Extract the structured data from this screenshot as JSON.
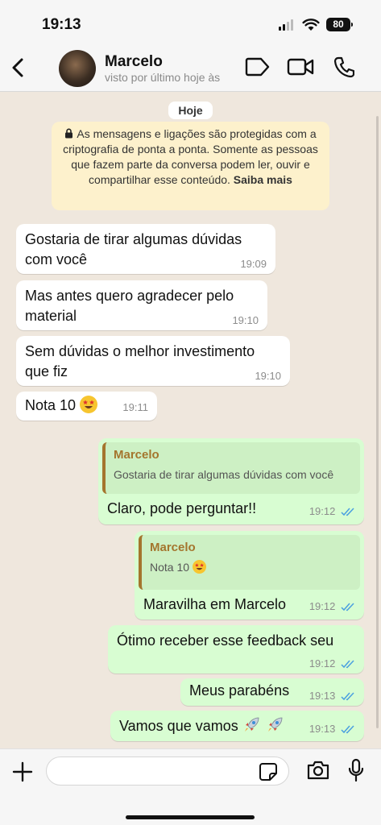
{
  "status_bar": {
    "time": "19:13",
    "battery": "80"
  },
  "header": {
    "contact_name": "Marcelo",
    "contact_status": "visto por último hoje às"
  },
  "chat": {
    "date_chip": "Hoje",
    "encryption_notice": {
      "text": "As mensagens e ligações são protegidas com a criptografia de ponta a ponta. Somente as pessoas que fazem parte da conversa podem ler, ouvir e compartilhar esse conteúdo.",
      "link": "Saiba mais"
    },
    "incoming": [
      {
        "text": "Gostaria de tirar algumas dúvidas com você",
        "time": "19:09"
      },
      {
        "text": "Mas antes quero agradecer pelo material",
        "time": "19:10"
      },
      {
        "text": "Sem dúvidas o melhor investimento que fiz",
        "time": "19:10"
      },
      {
        "text": "Nota 10",
        "time": "19:11"
      }
    ],
    "outgoing": [
      {
        "quote_name": "Marcelo",
        "quote_text": "Gostaria de tirar algumas dúvidas com você",
        "text": "Claro, pode perguntar!!",
        "time": "19:12"
      },
      {
        "quote_name": "Marcelo",
        "quote_text": "Nota 10",
        "text": "Maravilha em Marcelo",
        "time": "19:12"
      },
      {
        "text": "Ótimo receber esse feedback seu",
        "time": "19:12"
      },
      {
        "text": "Meus parabéns",
        "time": "19:13"
      },
      {
        "text": "Vamos que vamos",
        "time": "19:13"
      }
    ]
  },
  "composer": {
    "placeholder": ""
  },
  "colors": {
    "outgoing_bubble": "#d8fdd2",
    "incoming_bubble": "#ffffff",
    "quote_accent": "#a4752d",
    "read_ticks": "#4a9fe0",
    "wallpaper": "#efe7dd"
  },
  "icons": [
    "chevron-left-icon",
    "sticker-icon",
    "video-camera-icon",
    "phone-icon",
    "lock-icon",
    "double-check-icon",
    "plus-icon",
    "camera-icon",
    "microphone-icon",
    "star-struck-emoji",
    "rocket-emoji"
  ]
}
